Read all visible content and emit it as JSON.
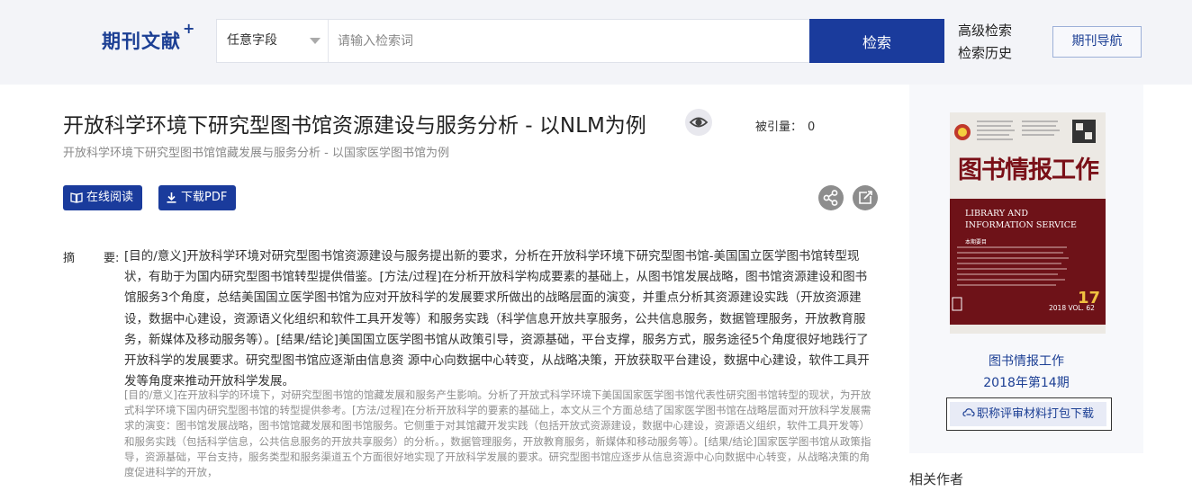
{
  "header": {
    "logo": "期刊文献",
    "logo_plus": "+",
    "field_select": "任意字段",
    "search_placeholder": "请输入检索词",
    "search_button": "检索",
    "advanced_search": "高级检索",
    "search_history": "检索历史",
    "journal_nav": "期刊导航"
  },
  "article": {
    "title": "开放科学环境下研究型图书馆资源建设与服务分析 - 以NLM为例",
    "subtitle": "开放科学环境下研究型图书馆馆藏发展与服务分析 - 以国家医学图书馆为例",
    "cited_label": "被引量：",
    "cited_count": "0",
    "read_online": "在线阅读",
    "download_pdf": "下载PDF",
    "abstract_label_1": "摘",
    "abstract_label_2": "要:",
    "abstract_cn": "[目的/意义]开放科学环境对研究型图书馆资源建设与服务提出新的要求，分析在开放科学环境下研究型图书馆-美国国立医学图书馆转型现状，有助于为国内研究型图书馆转型提供借鉴。[方法/过程]在分析开放科学构成要素的基础上，从图书馆发展战略，图书馆资源建设和图书馆服务3个角度，总结美国国立医学图书馆为应对开放科学的发展要求所做出的战略层面的演变，并重点分析其资源建设实践（开放资源建设，数据中心建设，资源语义化组织和软件工具开发等）和服务实践（科学信息开放共享服务，公共信息服务，数据管理服务，开放教育服务，新媒体及移动服务等）。[结果/结论]美国国立医学图书馆从政策引导，资源基础，平台支撑，服务方式，服务途径5个角度很好地践行了开放科学的发展要求。研究型图书馆应逐渐由信息资 源中心向数据中心转变，从战略决策，开放获取平台建设，数据中心建设，软件工具开发等角度来推动开放科学发展。",
    "abstract_en": "[目的/意义]在开放科学的环境下，对研究型图书馆的馆藏发展和服务产生影响。分析了开放式科学环境下美国国家医学图书馆代表性研究图书馆转型的现状，为开放式科学环境下国内研究型图书馆的转型提供参考。[方法/过程]在分析开放科学的要素的基础上，本文从三个方面总结了国家医学图书馆在战略层面对开放科学发展需求的演变：图书馆发展战略，图书馆馆藏发展和图书馆服务。它侧重于对其馆藏开发实践（包括开放式资源建设，数据中心建设，资源语义组织，软件工具开发等）和服务实践（包括科学信息，公共信息服务的开放共享服务）的分析。，数据管理服务，开放教育服务，新媒体和移动服务等）。[结果/结论]国家医学图书馆从政策指导，资源基础，平台支持，服务类型和服务渠道五个方面很好地实现了开放科学发展的要求。研究型图书馆应逐步从信息资源中心向数据中心转变，从战略决策的角度促进科学的开放，"
  },
  "sidebar": {
    "journal_name": "图书情报工作",
    "issue": "2018年第14期",
    "package_download": "职称评审材料打包下载",
    "related_authors": "相关作者",
    "cover": {
      "title_cn": "图书情报工作",
      "title_en_1": "LIBRARY AND",
      "title_en_2": "INFORMATION SERVICE",
      "issue_number": "17",
      "year_vol": "2018 VOL. 62",
      "section_label": "本期要目"
    }
  },
  "colors": {
    "brand_blue": "#1a3b9c",
    "cover_red": "#6e1218"
  }
}
